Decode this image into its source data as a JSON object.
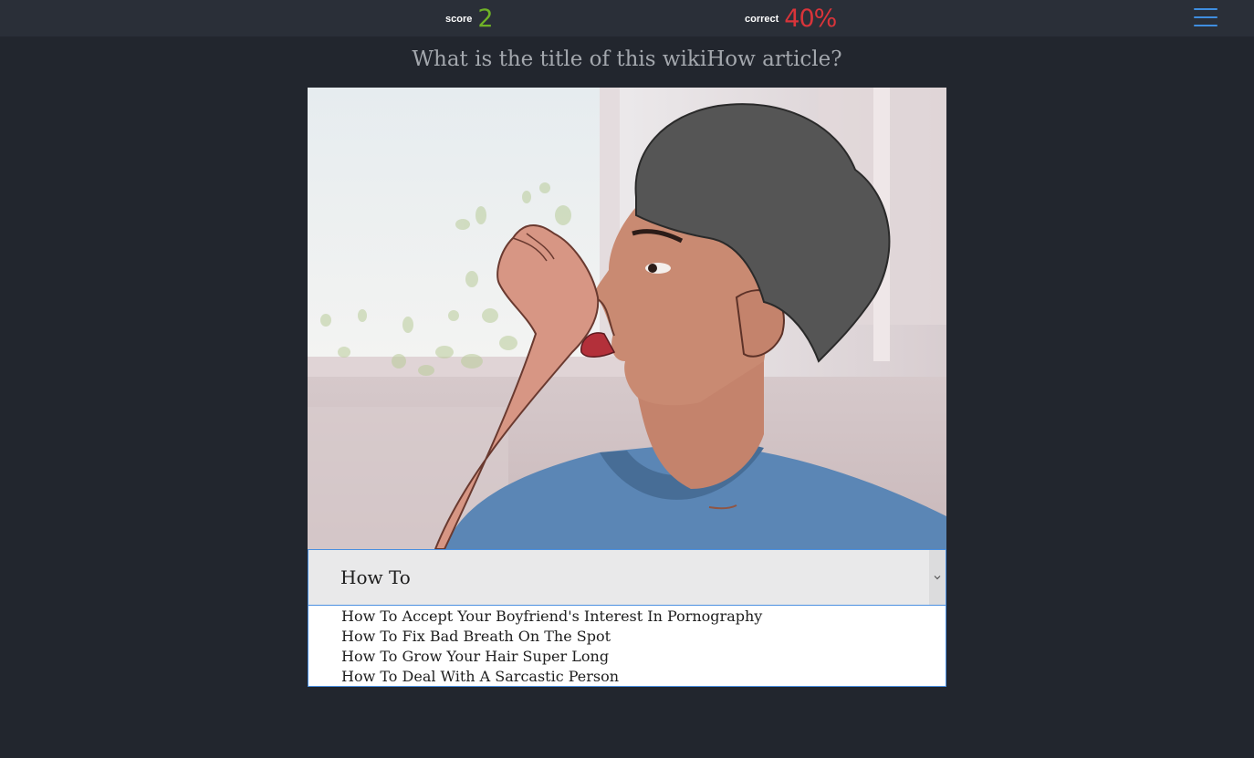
{
  "header": {
    "score_label": "score",
    "score_value": "2",
    "correct_label": "correct",
    "correct_value": "40%",
    "score_color": "#6fb227",
    "correct_color": "#d9343a",
    "menu_icon": "hamburger-menu-icon",
    "menu_color": "#3f8ee0"
  },
  "question": "What is the title of this wikiHow article?",
  "image": {
    "subject": "cartoon person licking wrist and smelling it"
  },
  "select": {
    "current_value": "How To",
    "options": [
      "How To Accept Your Boyfriend's Interest In Pornography",
      "How To Fix Bad Breath On The Spot",
      "How To Grow Your Hair Super Long",
      "How To Deal With A Sarcastic Person"
    ]
  }
}
